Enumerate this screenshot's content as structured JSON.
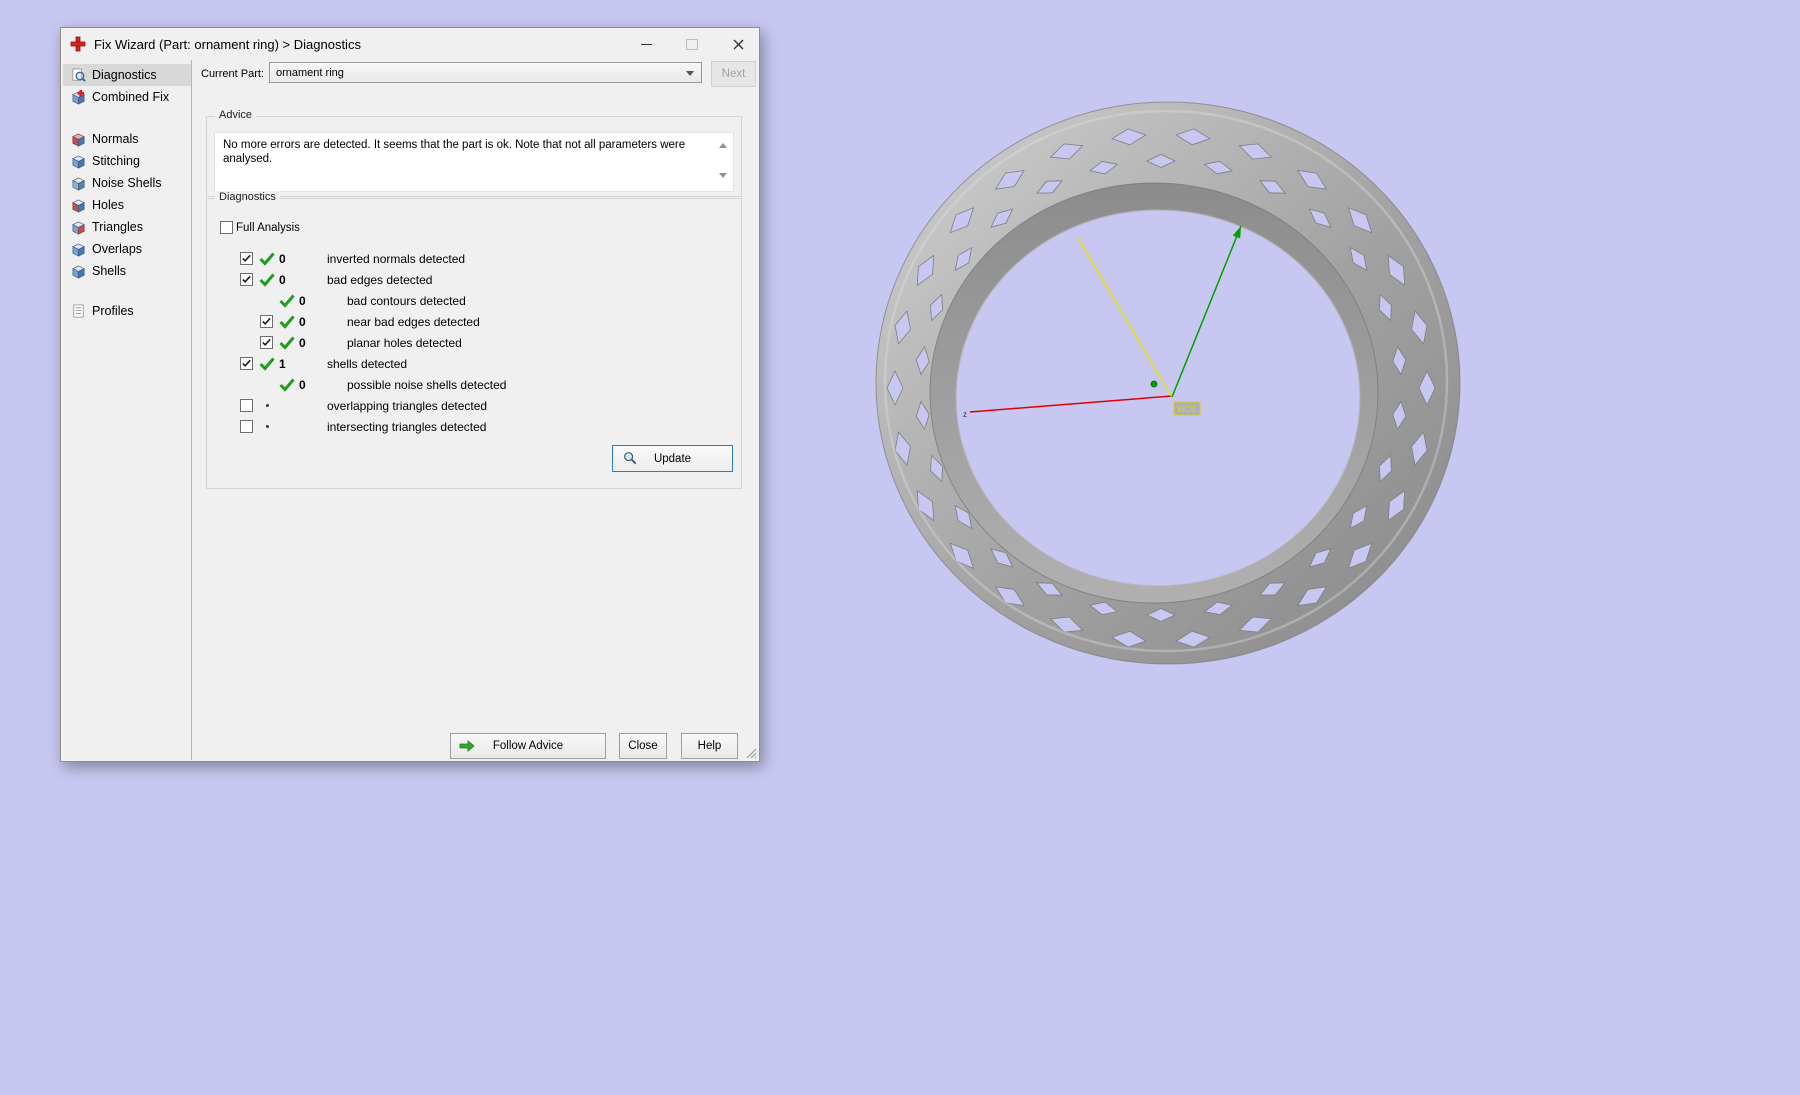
{
  "window": {
    "title": "Fix Wizard (Part: ornament ring) > Diagnostics"
  },
  "sidebar": {
    "selected": "Diagnostics",
    "items": [
      {
        "label": "Diagnostics",
        "icon": "diagnostics-icon"
      },
      {
        "label": "Combined Fix",
        "icon": "combined-fix-icon"
      },
      {
        "label": "Normals",
        "icon": "cube-icon"
      },
      {
        "label": "Stitching",
        "icon": "cube-icon"
      },
      {
        "label": "Noise Shells",
        "icon": "cube-icon"
      },
      {
        "label": "Holes",
        "icon": "cube-icon"
      },
      {
        "label": "Triangles",
        "icon": "cube-icon"
      },
      {
        "label": "Overlaps",
        "icon": "cube-icon"
      },
      {
        "label": "Shells",
        "icon": "cube-icon"
      },
      {
        "label": "Profiles",
        "icon": "profiles-icon"
      }
    ]
  },
  "header": {
    "current_part_label": "Current Part:",
    "part_value": "ornament ring",
    "next_label": "Next"
  },
  "advice": {
    "label": "Advice",
    "text": "No more errors are detected. It seems that the part is ok. Note that not all parameters were analysed."
  },
  "diagnostics": {
    "label": "Diagnostics",
    "full_analysis_label": "Full Analysis",
    "full_analysis_checked": false,
    "update_label": "Update",
    "rows": [
      {
        "indent": 0,
        "checkbox": true,
        "checked": true,
        "mark": "check",
        "count": "0",
        "label": "inverted normals detected"
      },
      {
        "indent": 0,
        "checkbox": true,
        "checked": true,
        "mark": "check",
        "count": "0",
        "label": "bad edges detected"
      },
      {
        "indent": 1,
        "checkbox": false,
        "checked": false,
        "mark": "check",
        "count": "0",
        "label": "bad contours detected"
      },
      {
        "indent": 1,
        "checkbox": true,
        "checked": true,
        "mark": "check",
        "count": "0",
        "label": "near bad edges detected"
      },
      {
        "indent": 1,
        "checkbox": true,
        "checked": true,
        "mark": "check",
        "count": "0",
        "label": "planar holes detected"
      },
      {
        "indent": 0,
        "checkbox": true,
        "checked": true,
        "mark": "check",
        "count": "1",
        "label": "shells detected"
      },
      {
        "indent": 1,
        "checkbox": false,
        "checked": false,
        "mark": "check",
        "count": "0",
        "label": "possible noise shells detected"
      },
      {
        "indent": 0,
        "checkbox": true,
        "checked": false,
        "mark": "dot",
        "count": "",
        "label": "overlapping triangles detected"
      },
      {
        "indent": 0,
        "checkbox": true,
        "checked": false,
        "mark": "dot",
        "count": "",
        "label": "intersecting triangles detected"
      }
    ]
  },
  "footer": {
    "follow_advice_label": "Follow Advice",
    "close_label": "Close",
    "help_label": "Help"
  },
  "viewport": {
    "wcs_label": "WCS",
    "axis_label_z": "z"
  },
  "colors": {
    "background": "#c7c7f1",
    "focus_blue": "#2d7dc1",
    "check_green": "#1f9d1f",
    "axis_red": "#e00000",
    "axis_green": "#00a000",
    "axis_yellow": "#e6e600",
    "ring_gray": "#a2a2a2"
  }
}
